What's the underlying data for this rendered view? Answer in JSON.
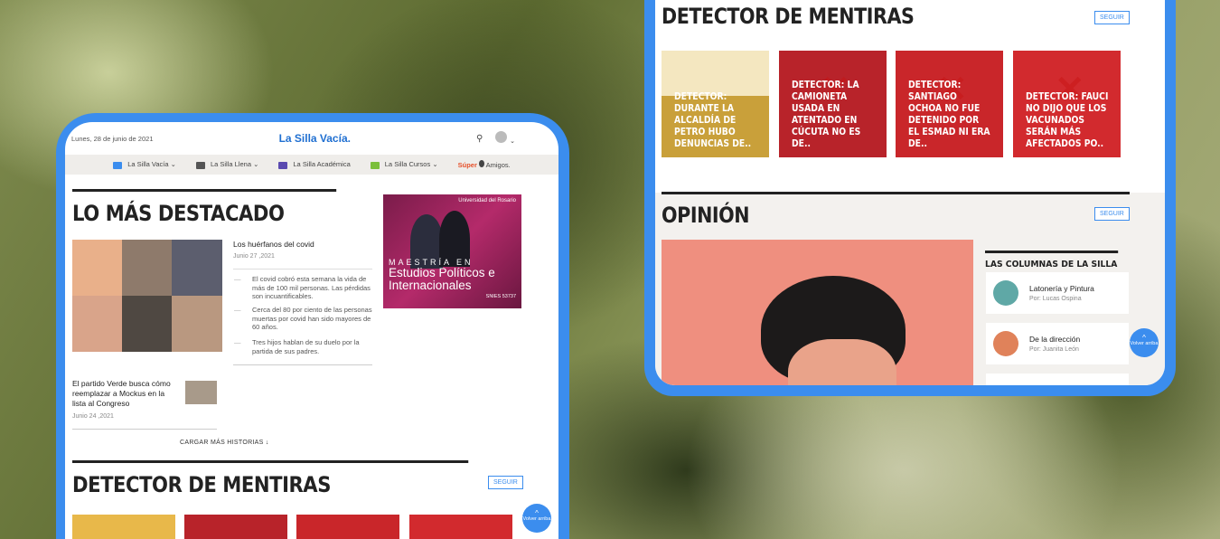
{
  "device1": {
    "date": "Lunes, 28 de junio de 2021",
    "logo": "La Silla Vacía.",
    "nav": [
      {
        "label": "La Silla Vacía",
        "color": "#3b8dee"
      },
      {
        "label": "La Silla Llena",
        "color": "#555555"
      },
      {
        "label": "La Silla Académica",
        "color": "#5a4ab0"
      },
      {
        "label": "La Silla Cursos",
        "color": "#7bbf3a"
      }
    ],
    "nav_super": "Súper",
    "nav_amigos": "Amigos.",
    "section_title": "LO MÁS DESTACADO",
    "main_story": {
      "title": "Los huérfanos del covid",
      "date": "Junio 27 ,2021",
      "bullets": [
        "El covid cobró esta semana la vida de más de 100 mil personas. Las pérdidas son incuantificables.",
        "Cerca del 80 por ciento de las personas muertas por covid han sido mayores de 60 años.",
        "Tres hijos hablan de su duelo por la partida de sus padres."
      ]
    },
    "second_story": {
      "title": "El partido Verde busca cómo reemplazar a Mockus en la lista al Congreso",
      "date": "Junio 24 ,2021"
    },
    "load_more": "CARGAR MÁS HISTORIAS ↓",
    "ad": {
      "university": "Universidad del Rosario",
      "line1": "MAESTRÍA EN",
      "line2": "Estudios Políticos e Internacionales",
      "snies": "SNIES 53737"
    },
    "detector_title": "DETECTOR DE MENTIRAS",
    "seguir": "SEGUIR",
    "fab": "Volver arriba"
  },
  "device2": {
    "detector_title": "DETECTOR DE MENTIRAS",
    "seguir": "SEGUIR",
    "cards": [
      {
        "title": "DETECTOR: DURANTE LA ALCALDÍA DE PETRO HUBO DENUNCIAS DE..",
        "bg": "#c9a03a"
      },
      {
        "title": "DETECTOR: LA CAMIONETA USADA EN ATENTADO EN CÚCUTA NO ES DE..",
        "bg": "#b8232a"
      },
      {
        "title": "DETECTOR: SANTIAGO OCHOA NO FUE DETENIDO POR EL ESMAD NI ERA DE..",
        "bg": "#c9262a"
      },
      {
        "title": "DETECTOR: FAUCI NO DIJO QUE LOS VACUNADOS SERÁN MÁS AFECTADOS PO..",
        "bg": "#d22a2e"
      }
    ],
    "opinion_title": "OPINIÓN",
    "opinion_seguir": "SEGUIR",
    "columns_title": "LAS COLUMNAS DE LA SILLA",
    "columns": [
      {
        "name": "Latonería y Pintura",
        "author": "Por: Lucas Ospina",
        "color": "#5fa8a6"
      },
      {
        "name": "De la dirección",
        "author": "Por: Juanita León",
        "color": "#e0825a"
      }
    ],
    "fab": "Volver arriba"
  }
}
